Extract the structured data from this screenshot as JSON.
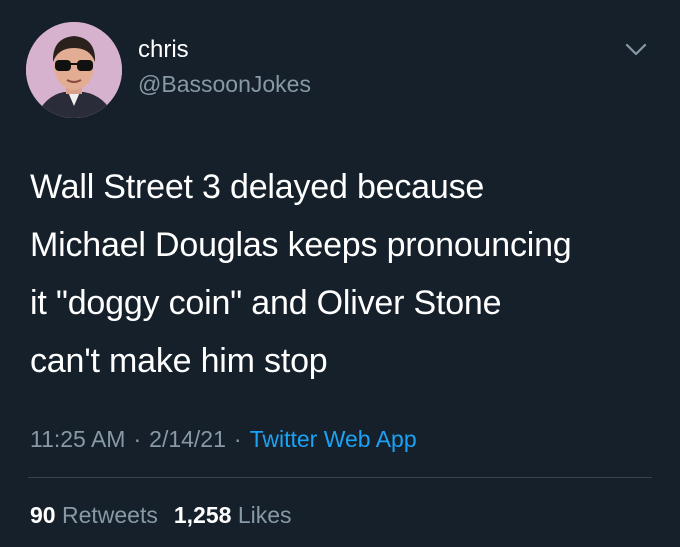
{
  "author": {
    "display_name": "chris",
    "handle": "@BassoonJokes",
    "avatar_icon": "profile-photo",
    "avatar_bg": "#d7b2cf"
  },
  "menu": {
    "icon": "chevron-down-icon"
  },
  "tweet": {
    "text": "Wall Street 3 delayed because\nMichael Douglas keeps pronouncing\nit \"doggy coin\" and Oliver Stone\ncan't make him stop"
  },
  "meta": {
    "time": "11:25 AM",
    "date": "2/14/21",
    "separator": "·",
    "source": "Twitter Web App"
  },
  "stats": {
    "retweets_count": "90",
    "retweets_label": "Retweets",
    "likes_count": "1,258",
    "likes_label": "Likes"
  },
  "colors": {
    "background": "#15202b",
    "text": "#ffffff",
    "muted": "#8899a6",
    "link": "#1da1f2",
    "divider": "#38444d"
  }
}
